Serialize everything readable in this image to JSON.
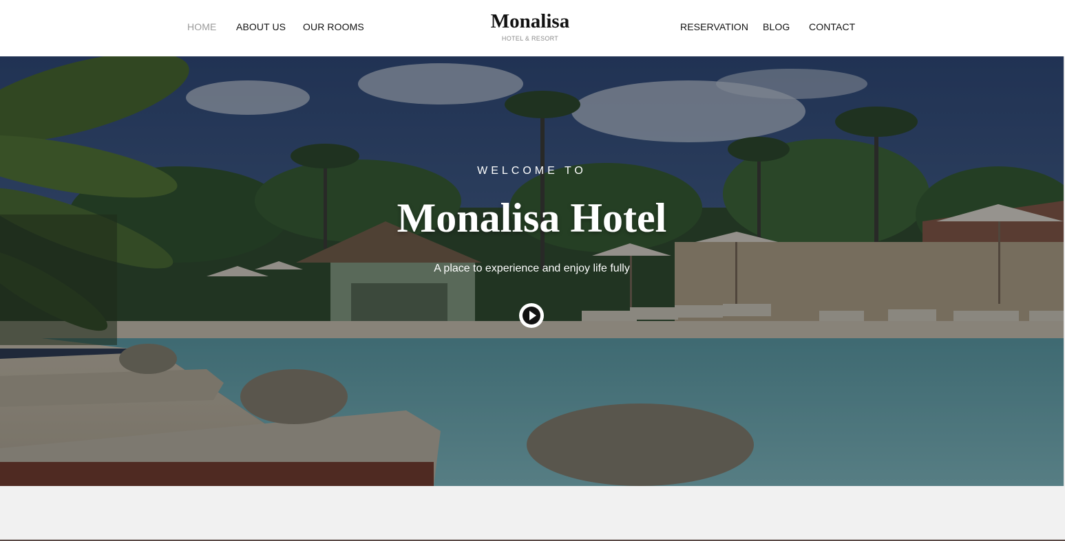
{
  "nav": {
    "left": [
      {
        "label": "HOME",
        "active": true
      },
      {
        "label": "ABOUT US",
        "active": false
      },
      {
        "label": "OUR ROOMS",
        "active": false
      }
    ],
    "right": [
      {
        "label": "RESERVATION",
        "active": false
      },
      {
        "label": "BLOG",
        "active": false
      },
      {
        "label": "CONTACT",
        "active": false
      }
    ]
  },
  "brand": {
    "name": "Monalisa",
    "tagline": "HOTEL & RESORT"
  },
  "hero": {
    "welcome": "WELCOME TO",
    "title": "Monalisa Hotel",
    "subtitle": "A place to experience and enjoy life fully",
    "play_icon": "play-icon",
    "background_image": "resort-pool-with-palm-trees"
  },
  "colors": {
    "nav_text": "#111111",
    "nav_active": "#9a9a9a",
    "hero_text": "#ffffff",
    "page_bg": "#f1f1f1"
  }
}
